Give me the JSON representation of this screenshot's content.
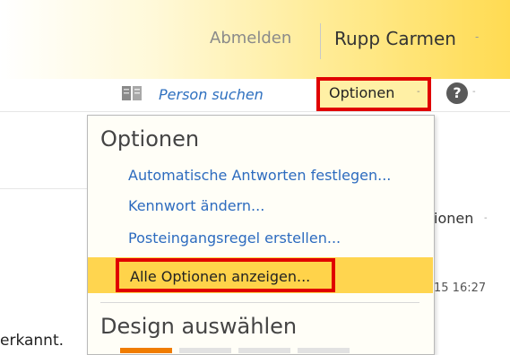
{
  "header": {
    "signout_label": "Abmelden",
    "username": "Rupp Carmen",
    "caret": "-"
  },
  "toolbar": {
    "find_person_label": "Person suchen",
    "options_label": "Optionen",
    "options_caret": "-",
    "help_symbol": "?",
    "help_caret": "-",
    "icons": {
      "book": "book-icon",
      "help": "help-icon"
    },
    "colors": {
      "highlight_border": "#e00000",
      "button_fill": "#fff0a5"
    }
  },
  "background": {
    "options_label_partial": "ionen",
    "options_caret": "-",
    "timestamp_partial": "15 16:27",
    "status_partial": "erkannt."
  },
  "menu": {
    "header": "Optionen",
    "items": [
      {
        "label": "Automatische Antworten festlegen..."
      },
      {
        "label": "Kennwort ändern..."
      },
      {
        "label": "Posteingangsregel erstellen..."
      },
      {
        "label": "Alle Optionen anzeigen..."
      }
    ],
    "design_header": "Design auswählen",
    "colors": {
      "hover_band": "#ffd54f",
      "link": "#2c6bbf",
      "selected_theme": "#f07c00"
    }
  }
}
